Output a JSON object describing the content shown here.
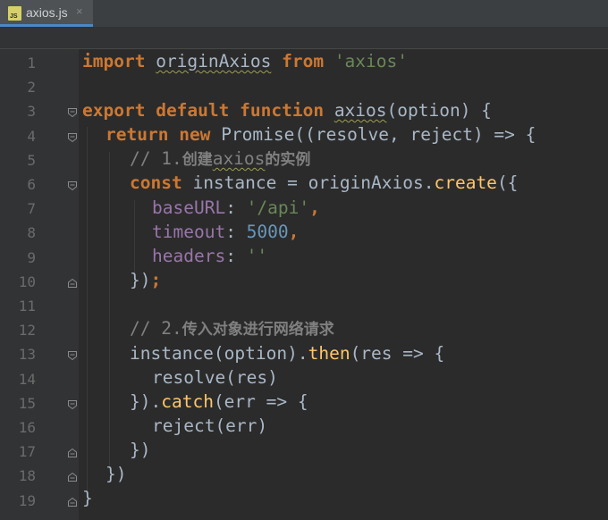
{
  "tab": {
    "title": "axios.js",
    "icon_text": "JS",
    "close": "×"
  },
  "gutter": {
    "line_numbers": [
      "1",
      "2",
      "3",
      "4",
      "5",
      "6",
      "7",
      "8",
      "9",
      "10",
      "11",
      "12",
      "13",
      "14",
      "15",
      "16",
      "17",
      "18",
      "19"
    ]
  },
  "code": {
    "l1": {
      "import": "import",
      "name": "originAxios",
      "from": "from",
      "src": "'axios'"
    },
    "l3": {
      "export": "export",
      "default": "default",
      "function": "function",
      "name": "axios",
      "params": "(option) {"
    },
    "l4": {
      "return": "return",
      "new": "new",
      "rest": "Promise((resolve, reject) => {"
    },
    "l5": {
      "prefix": "// 1.",
      "cjk1": "创建",
      "word": "axios",
      "cjk2": "的实例"
    },
    "l6": {
      "const": "const",
      "mid": "instance = originAxios.",
      "fn": "create",
      "end": "({"
    },
    "l7": {
      "key": "baseURL",
      "colon": ": ",
      "value": "'/api'",
      "comma": ","
    },
    "l8": {
      "key": "timeout",
      "colon": ": ",
      "value": "5000",
      "comma": ","
    },
    "l9": {
      "key": "headers",
      "colon": ": ",
      "value": "''"
    },
    "l10": {
      "text": "})",
      "semi": ";"
    },
    "l12": {
      "prefix": "// 2.",
      "cjk": "传入对象进行网络请求"
    },
    "l13": {
      "a": "instance(option).",
      "fn": "then",
      "b": "(res => {"
    },
    "l14": {
      "text": "resolve(res)"
    },
    "l15": {
      "a": "}).",
      "fn": "catch",
      "b": "(err => {"
    },
    "l16": {
      "text": "reject(err)"
    },
    "l17": {
      "text": "})"
    },
    "l18": {
      "text": "})"
    },
    "l19": {
      "text": "}"
    }
  },
  "colors": {
    "background": "#2b2b2b",
    "keyword": "#cc7832",
    "string": "#6a8759",
    "number": "#6897bb",
    "property": "#9876aa",
    "method": "#ffc66d",
    "comment": "#808080",
    "text": "#a9b7c6"
  }
}
